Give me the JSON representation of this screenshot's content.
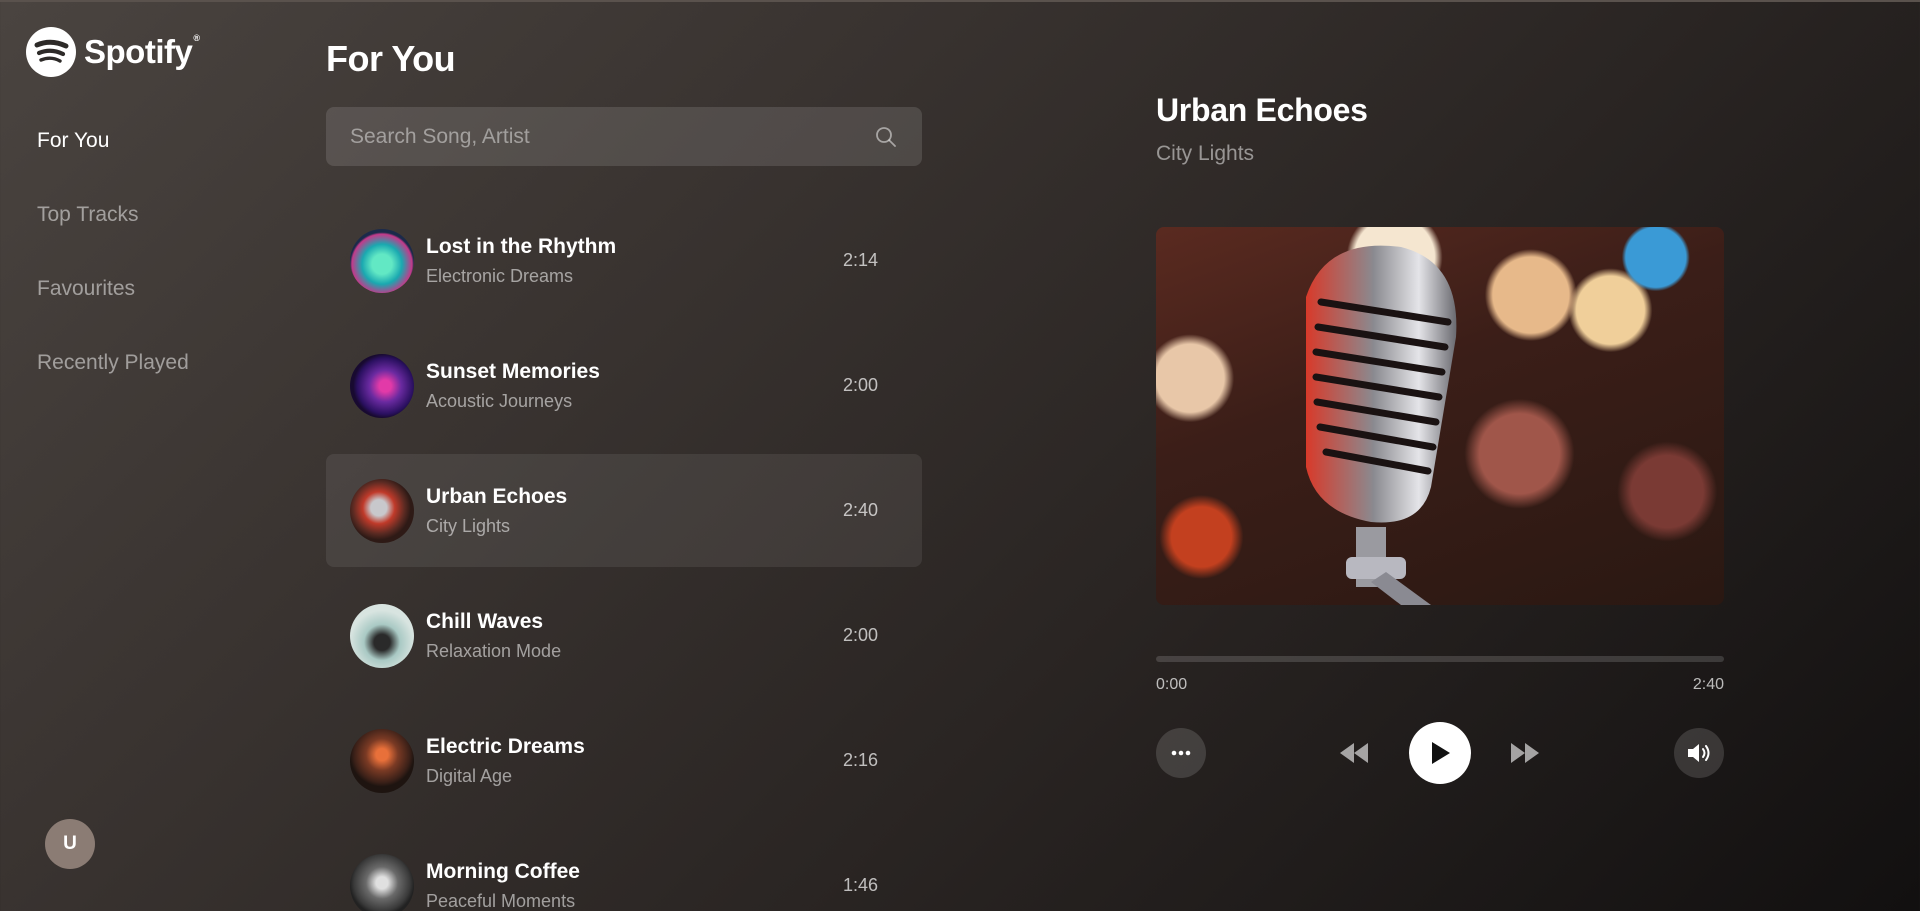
{
  "app": {
    "name": "Spotify",
    "registered_mark": "®"
  },
  "sidebar": {
    "items": [
      {
        "label": "For You",
        "active": true
      },
      {
        "label": "Top Tracks",
        "active": false
      },
      {
        "label": "Favourites",
        "active": false
      },
      {
        "label": "Recently Played",
        "active": false
      }
    ],
    "avatar_initial": "U"
  },
  "main": {
    "title": "For You",
    "search": {
      "placeholder": "Search Song, Artist",
      "value": ""
    }
  },
  "tracks": [
    {
      "title": "Lost in the Rhythm",
      "artist": "Electronic Dreams",
      "duration": "2:14",
      "active": false
    },
    {
      "title": "Sunset Memories",
      "artist": "Acoustic Journeys",
      "duration": "2:00",
      "active": false
    },
    {
      "title": "Urban Echoes",
      "artist": "City Lights",
      "duration": "2:40",
      "active": true
    },
    {
      "title": "Chill Waves",
      "artist": "Relaxation Mode",
      "duration": "2:00",
      "active": false
    },
    {
      "title": "Electric Dreams",
      "artist": "Digital Age",
      "duration": "2:16",
      "active": false
    },
    {
      "title": "Morning Coffee",
      "artist": "Peaceful Moments",
      "duration": "1:46",
      "active": false
    }
  ],
  "player": {
    "title": "Urban Echoes",
    "artist": "City Lights",
    "current_time": "0:00",
    "total_time": "2:40",
    "progress": 0
  },
  "icons": {
    "more": "more-dots-icon",
    "prev": "rewind-icon",
    "play": "play-icon",
    "next": "fast-forward-icon",
    "volume": "volume-icon",
    "search": "search-icon"
  },
  "colors": {
    "background": "#3a3431",
    "accent": "#ffffff",
    "avatar": "#8b7c74"
  }
}
